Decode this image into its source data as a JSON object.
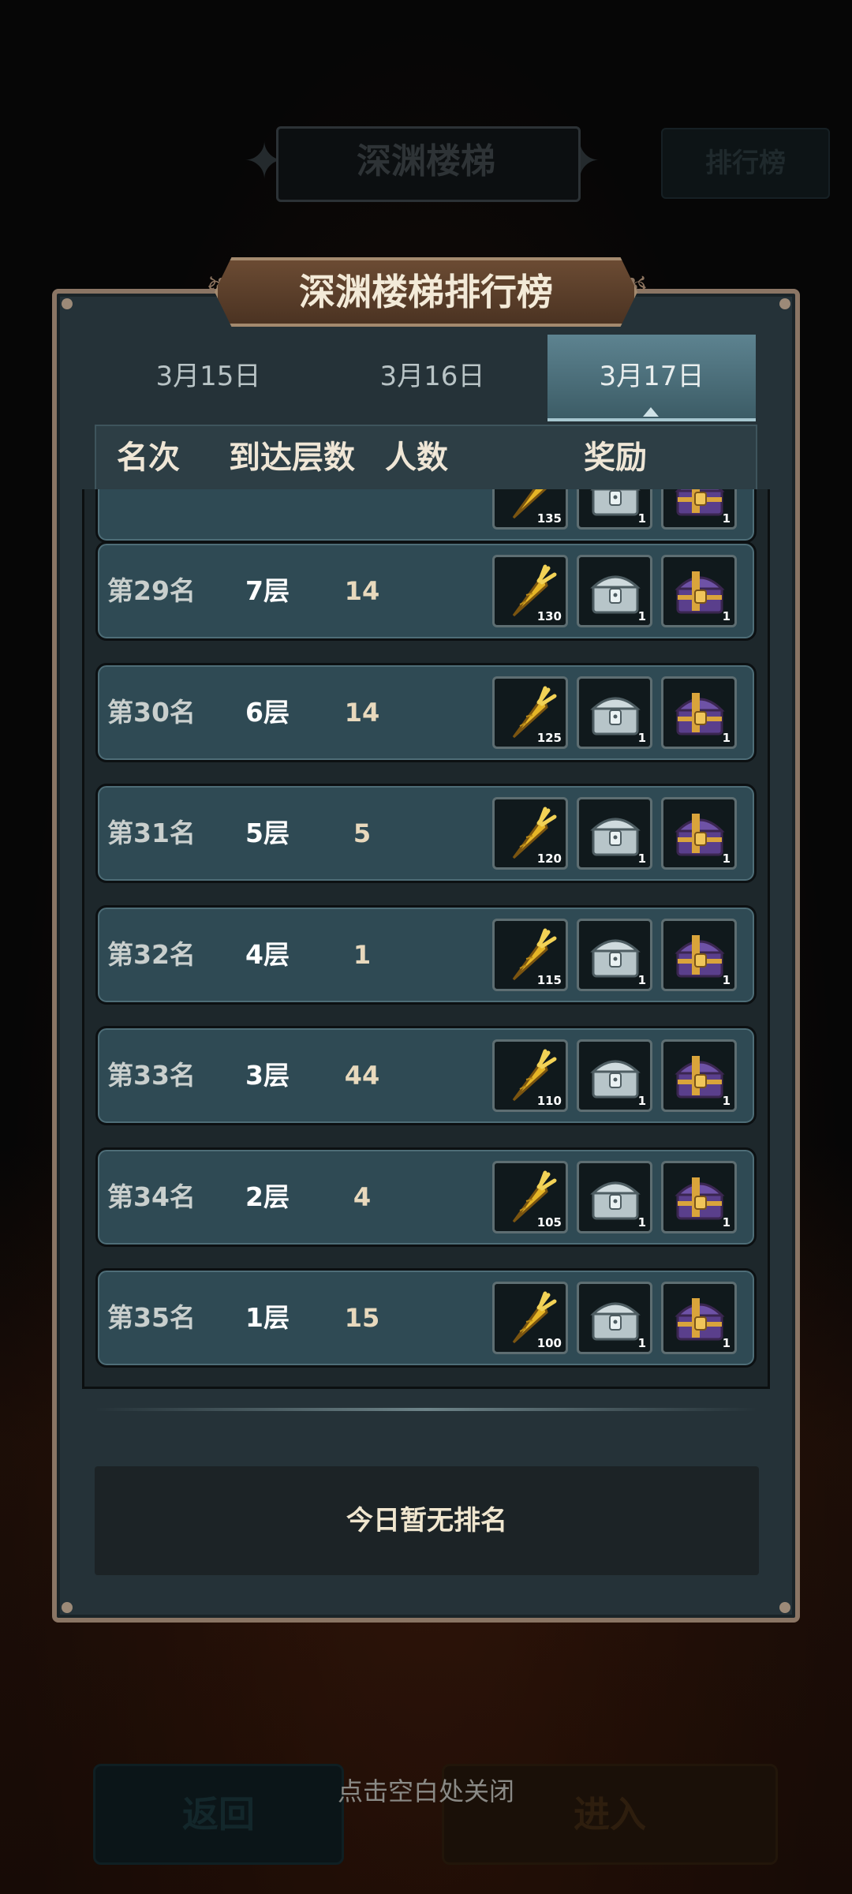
{
  "background": {
    "title": "深渊楼梯",
    "rank_button": "排行榜",
    "back_button": "返回",
    "enter_button": "进入"
  },
  "modal": {
    "title": "深渊楼梯排行榜",
    "tabs": [
      {
        "label": "3月15日",
        "active": false
      },
      {
        "label": "3月16日",
        "active": false
      },
      {
        "label": "3月17日",
        "active": true
      }
    ],
    "columns": {
      "rank": "名次",
      "floor": "到达层数",
      "people": "人数",
      "reward": "奖励"
    },
    "partial_row": {
      "carrot": "135",
      "chest_silver": "1",
      "chest_gold": "1"
    },
    "rows": [
      {
        "rank": "第29名",
        "floor": "7层",
        "people": "14",
        "carrot": "130",
        "chest_silver": "1",
        "chest_gold": "1"
      },
      {
        "rank": "第30名",
        "floor": "6层",
        "people": "14",
        "carrot": "125",
        "chest_silver": "1",
        "chest_gold": "1"
      },
      {
        "rank": "第31名",
        "floor": "5层",
        "people": "5",
        "carrot": "120",
        "chest_silver": "1",
        "chest_gold": "1"
      },
      {
        "rank": "第32名",
        "floor": "4层",
        "people": "1",
        "carrot": "115",
        "chest_silver": "1",
        "chest_gold": "1"
      },
      {
        "rank": "第33名",
        "floor": "3层",
        "people": "44",
        "carrot": "110",
        "chest_silver": "1",
        "chest_gold": "1"
      },
      {
        "rank": "第34名",
        "floor": "2层",
        "people": "4",
        "carrot": "105",
        "chest_silver": "1",
        "chest_gold": "1"
      },
      {
        "rank": "第35名",
        "floor": "1层",
        "people": "15",
        "carrot": "100",
        "chest_silver": "1",
        "chest_gold": "1"
      }
    ],
    "my_rank_text": "今日暂无排名"
  },
  "close_hint": "点击空白处关闭",
  "icons": {
    "carrot": "golden-carrot-icon",
    "chest_silver": "silver-chest-icon",
    "chest_gold": "purple-gold-chest-icon"
  },
  "colors": {
    "accent_tab": "#4e7783",
    "row_bg": "#2f4a54",
    "frame_border": "#8a7564"
  }
}
